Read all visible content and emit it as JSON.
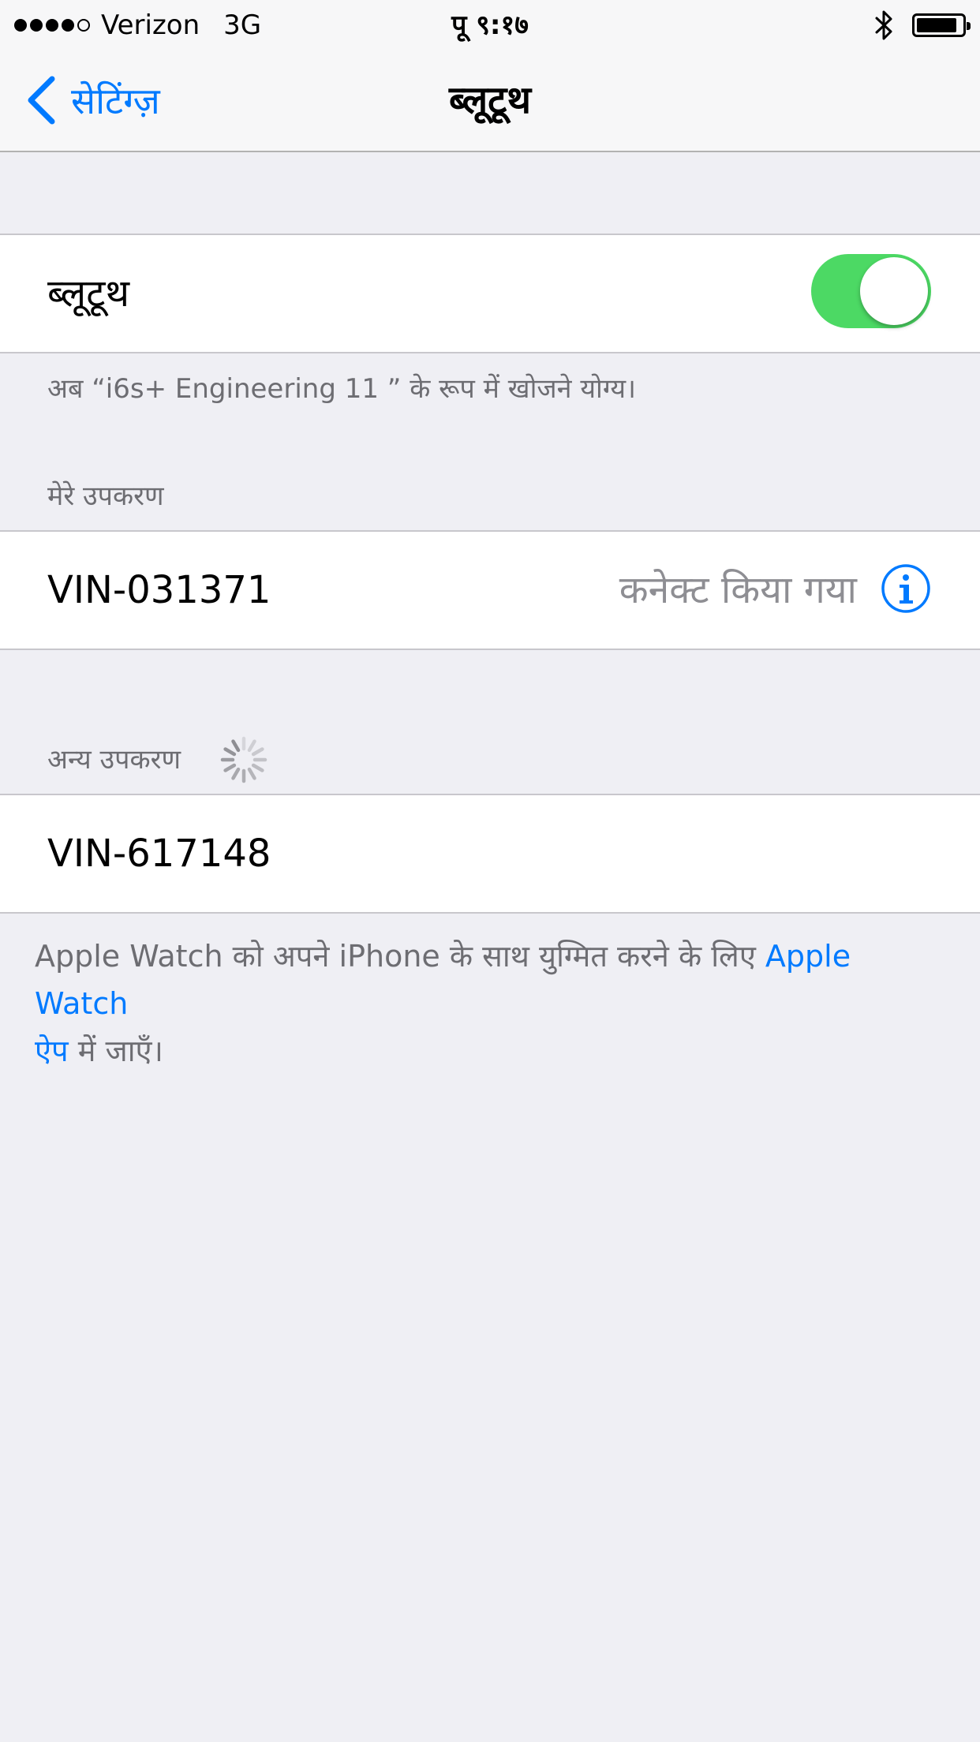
{
  "status_bar": {
    "signal_filled": 4,
    "signal_total": 5,
    "carrier": "Verizon",
    "network": "3G",
    "time": "पू ९:१७",
    "bluetooth_icon": "bluetooth-icon",
    "battery_level": 0.9
  },
  "nav": {
    "back_label": "सेटिंग्ज़",
    "title": "ब्लूटूथ"
  },
  "bluetooth_toggle": {
    "label": "ब्लूटूथ",
    "on": true,
    "color": "#4cd964"
  },
  "discoverable_text": "अब “i6s+ Engineering 11 ” के रूप में खोजने योग्य।",
  "my_devices": {
    "header": "मेरे उपकरण",
    "items": [
      {
        "name": "VIN-031371",
        "status": "कनेक्ट किया गया"
      }
    ]
  },
  "other_devices": {
    "header": "अन्य उपकरण",
    "items": [
      {
        "name": "VIN-617148"
      }
    ]
  },
  "footer": {
    "text_before": "Apple Watch को अपने iPhone के साथ युग्मित करने के लिए ",
    "link_line1": "Apple Watch",
    "link_line2": "ऐप",
    "text_after": " में जाएँ।"
  },
  "colors": {
    "accent": "#007aff",
    "background": "#efeff4",
    "secondary_text": "#6d6d72"
  }
}
